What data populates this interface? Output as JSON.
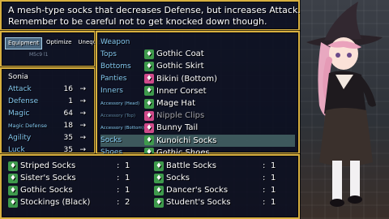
{
  "help": {
    "line1": "A mesh-type socks that decreases Defense, but increases Attack.",
    "line2": "Remember to be careful not to get knocked down though."
  },
  "commands": {
    "equipment": "Equipment",
    "optimize": "Optimize",
    "unequip_all": "Unequip All",
    "sub_text": "M5c9 l1"
  },
  "actor": {
    "name": "Sonia",
    "stats": [
      {
        "label": "Attack",
        "value": "16",
        "arrow": "→",
        "small": false
      },
      {
        "label": "Defense",
        "value": "1",
        "arrow": "→",
        "small": false
      },
      {
        "label": "Magic",
        "value": "64",
        "arrow": "→",
        "small": false
      },
      {
        "label": "Magic Defense",
        "value": "18",
        "arrow": "→",
        "small": true
      },
      {
        "label": "Agility",
        "value": "35",
        "arrow": "→",
        "small": false
      },
      {
        "label": "Luck",
        "value": "35",
        "arrow": "→",
        "small": false
      }
    ]
  },
  "slots": [
    {
      "slot": "Weapon",
      "item": "",
      "icon": ""
    },
    {
      "slot": "Tops",
      "item": "Gothic Coat",
      "icon": "green"
    },
    {
      "slot": "Bottoms",
      "item": "Gothic Skirt",
      "icon": "green"
    },
    {
      "slot": "Panties",
      "item": "Bikini (Bottom)",
      "icon": "pink"
    },
    {
      "slot": "Inners",
      "item": "Inner Corset",
      "icon": "green"
    },
    {
      "slot": "Accessory (Head)",
      "item": "Mage Hat",
      "icon": "green"
    },
    {
      "slot": "Accessory (Top)",
      "item": "Nipple Clips",
      "icon": "pink"
    },
    {
      "slot": "Accessory (Bottom)",
      "item": "Bunny Tail",
      "icon": "pink"
    },
    {
      "slot": "Socks",
      "item": "Kunoichi Socks",
      "icon": "green"
    },
    {
      "slot": "Shoes",
      "item": "Gothic Shoes",
      "icon": "green"
    }
  ],
  "items_left": [
    {
      "name": "Striped Socks",
      "sep": ":",
      "count": "1"
    },
    {
      "name": "Sister's Socks",
      "sep": ":",
      "count": "1"
    },
    {
      "name": "Gothic Socks",
      "sep": ":",
      "count": "1"
    },
    {
      "name": "Stockings (Black)",
      "sep": ":",
      "count": "2"
    }
  ],
  "items_right": [
    {
      "name": "Battle Socks",
      "sep": ":",
      "count": "1"
    },
    {
      "name": "Socks",
      "sep": ":",
      "count": "1"
    },
    {
      "name": "Dancer's Socks",
      "sep": ":",
      "count": "1"
    },
    {
      "name": "Student's Socks",
      "sep": ":",
      "count": "1"
    }
  ],
  "colors": {
    "border": "#d8b040",
    "param_label": "#84c8f0",
    "selection": "#96dcc8"
  }
}
